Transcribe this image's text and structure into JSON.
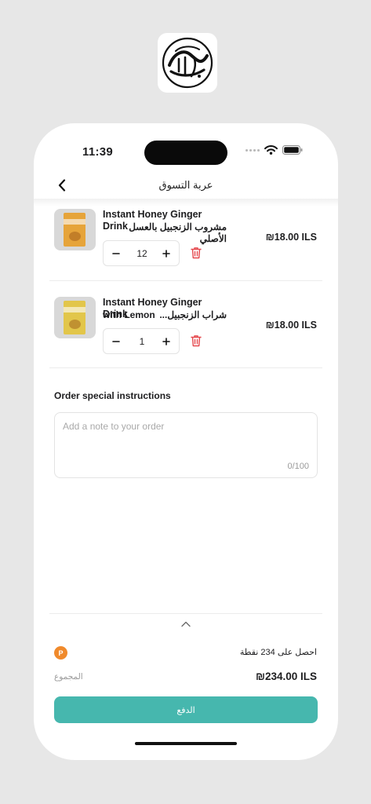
{
  "status_bar": {
    "time": "11:39"
  },
  "header": {
    "title": "عربة التسوق"
  },
  "cart": {
    "items": [
      {
        "name": "Instant Honey Ginger Drink",
        "name_ar": "مشروب الزنجبيل بالعسل الأصلي",
        "price": "₪18.00 ILS",
        "quantity": "12",
        "package_color": "#e6a43a"
      },
      {
        "name": "Instant Honey Ginger Drink",
        "name_line2": "with Lemon",
        "name_ar": "شراب الزنجبيل...",
        "price": "₪18.00 ILS",
        "quantity": "1",
        "package_color": "#e2c64a"
      }
    ]
  },
  "instructions": {
    "label": "Order special instructions",
    "placeholder": "Add a note to your order",
    "counter": "0/100"
  },
  "footer": {
    "points_badge": "P",
    "points_text": "احصل على 234 نقطة",
    "total_label": "المجموع",
    "total_value": "₪234.00 ILS",
    "pay_label": "الدفع"
  },
  "colors": {
    "accent": "#46b7ae",
    "points_badge": "#f08a2c",
    "delete": "#e5484d"
  },
  "icons": [
    "logo-calligraphy-icon",
    "wifi-icon",
    "battery-icon",
    "back-chevron-icon",
    "minus-icon",
    "plus-icon",
    "trash-icon",
    "chevron-up-icon"
  ]
}
